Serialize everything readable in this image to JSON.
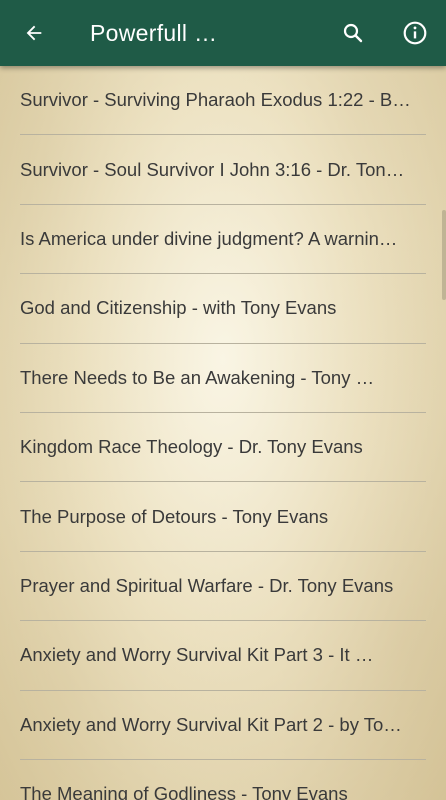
{
  "appbar": {
    "title": "Powerfull …",
    "back_icon": "arrow-left-icon",
    "search_icon": "search-icon",
    "info_icon": "info-icon",
    "color": "#1f5b47"
  },
  "list": {
    "items": [
      {
        "label": "Survivor - Surviving Pharaoh Exodus 1:22 - B…"
      },
      {
        "label": "Survivor - Soul Survivor I John 3:16 - Dr. Ton…"
      },
      {
        "label": "Is America under divine judgment? A warnin…"
      },
      {
        "label": "God and Citizenship - with Tony Evans"
      },
      {
        "label": "There Needs to Be an Awakening - Tony …"
      },
      {
        "label": "Kingdom Race Theology - Dr. Tony Evans"
      },
      {
        "label": "The Purpose of Detours - Tony Evans"
      },
      {
        "label": "Prayer and Spiritual Warfare - Dr. Tony Evans"
      },
      {
        "label": "Anxiety and Worry Survival Kit Part 3 - It …"
      },
      {
        "label": "Anxiety and Worry Survival Kit Part 2 - by To…"
      },
      {
        "label": "The Meaning of Godliness - Tony Evans"
      }
    ]
  }
}
